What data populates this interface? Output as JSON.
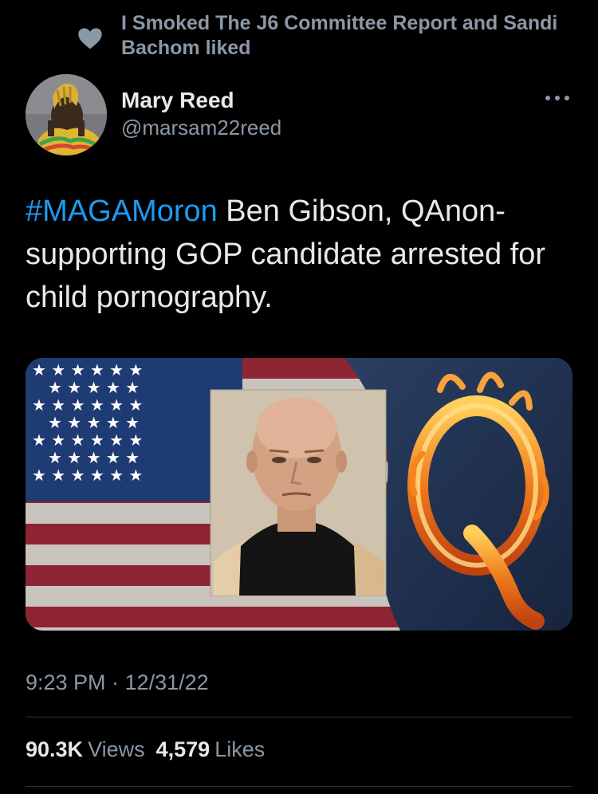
{
  "social_context": {
    "text": "I Smoked The J6 Committee Report and Sandi Bachom liked",
    "icon": "heart-icon"
  },
  "author": {
    "name": "Mary Reed",
    "handle": "@marsam22reed"
  },
  "tweet": {
    "hashtag": "#MAGAMoron",
    "text": " Ben Gibson, QAnon-supporting GOP candidate arrested for child pornography.",
    "timestamp": "9:23 PM · 12/31/22"
  },
  "media": {
    "letter": "Q"
  },
  "stats": {
    "views_count": "90.3K",
    "views_label": "Views",
    "likes_count": "4,579",
    "likes_label": "Likes"
  },
  "colors": {
    "background": "#000000",
    "text": "#e7e9ea",
    "secondary_text": "#8b98a5",
    "link": "#1d9bf0",
    "divider": "#2f3336"
  }
}
